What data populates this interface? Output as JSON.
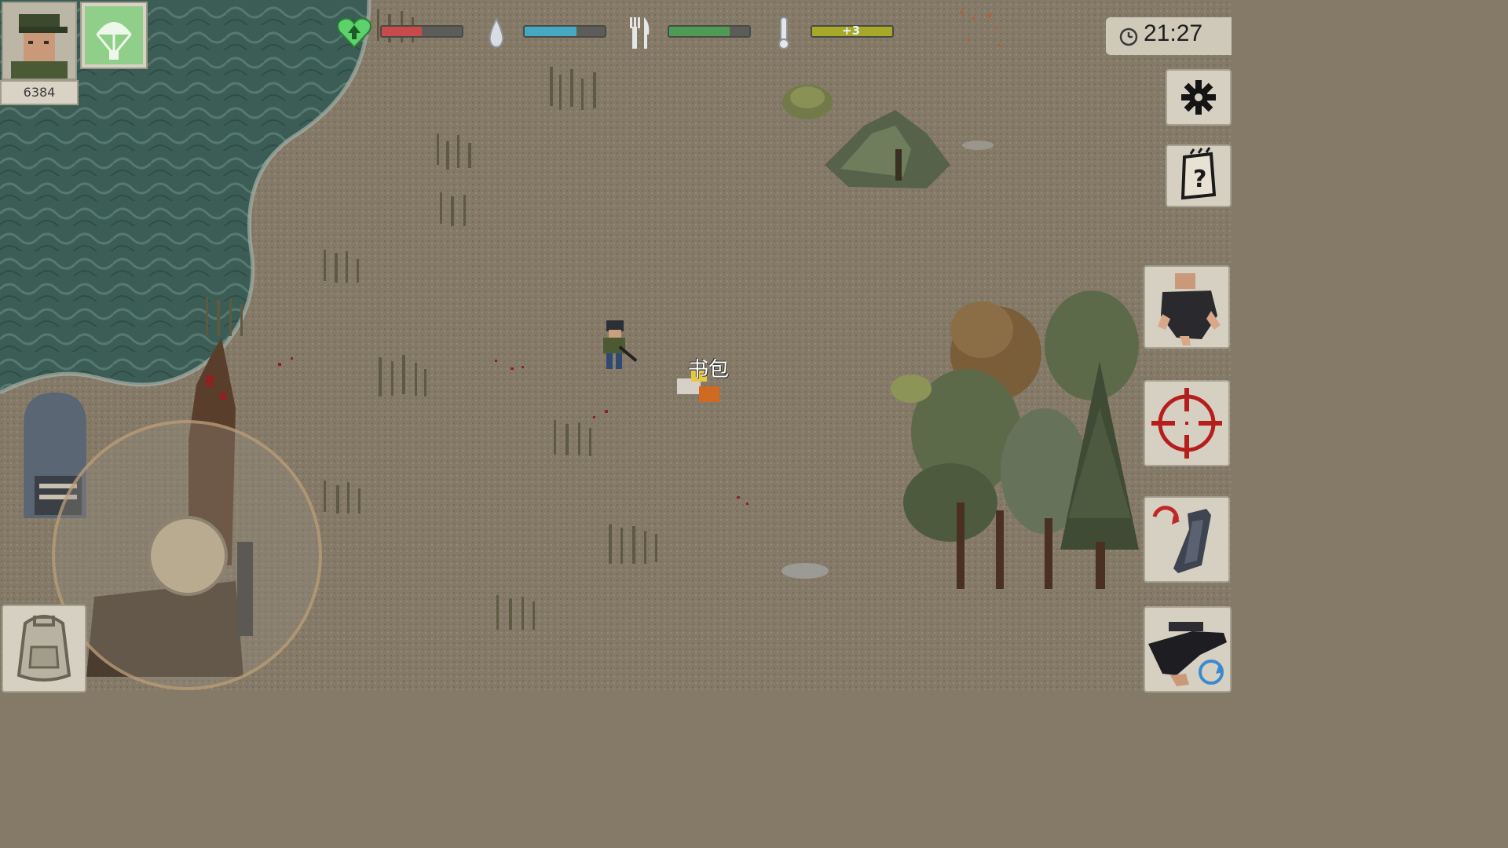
{
  "player": {
    "score": "6384",
    "portrait_icon": "soldier-portrait",
    "airdrop_icon": "parachute-icon"
  },
  "status_bars": [
    {
      "name": "health",
      "icon": "heart-icon",
      "color": "#c84a4a",
      "level": 0.5
    },
    {
      "name": "thirst",
      "icon": "water-drop-icon",
      "color": "#46a8c2",
      "level": 0.65
    },
    {
      "name": "hunger",
      "icon": "fork-knife-icon",
      "color": "#4f9a55",
      "level": 0.75
    },
    {
      "name": "temperature",
      "icon": "thermometer-icon",
      "color": "#a8a828",
      "level": 1.0,
      "label": "+3"
    }
  ],
  "clock": {
    "time": "21:27",
    "icon": "clock-icon"
  },
  "world": {
    "item_label": "书包"
  },
  "right_buttons": [
    {
      "name": "settings-button",
      "icon": "gear-icon"
    },
    {
      "name": "quest-button",
      "icon": "notepad-question-icon"
    },
    {
      "name": "interact-button",
      "icon": "grab-hand-icon"
    },
    {
      "name": "aim-button",
      "icon": "crosshair-icon"
    },
    {
      "name": "reload-button",
      "icon": "reload-magazine-icon"
    },
    {
      "name": "weapon-switch-button",
      "icon": "rifle-icon"
    }
  ],
  "left_buttons": [
    {
      "name": "inventory-button",
      "icon": "backpack-icon"
    }
  ],
  "colors": {
    "ground": "#857a68",
    "water": "#3d6058",
    "shore_foam": "#9aa59c",
    "tree_dark": "#4e5a40",
    "tree_brown": "#7a5e3a"
  }
}
